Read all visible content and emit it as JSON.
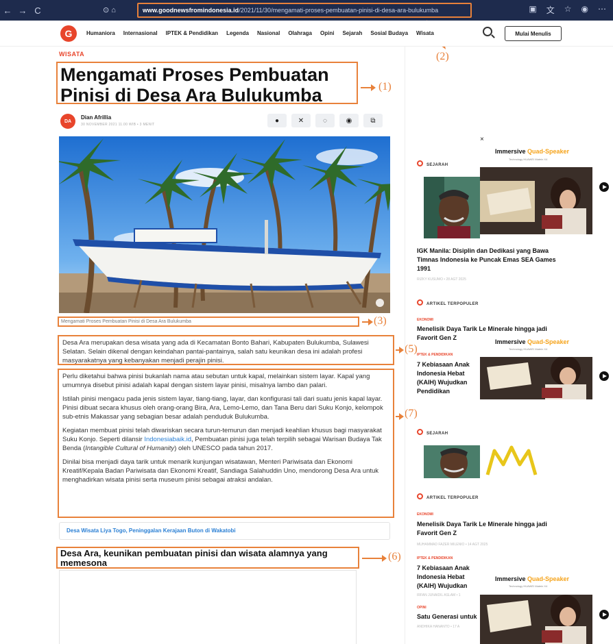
{
  "browser": {
    "url_domain": "www.goodnewsfromindonesia.id",
    "url_path": "/2021/11/30/mengamati-proses-pembuatan-pinisi-di-desa-ara-bulukumba",
    "back_icon": "←",
    "forward_icon": "→",
    "reload_icon": "C"
  },
  "site": {
    "logo_letter": "G",
    "menu": [
      "Humaniora",
      "Internasional",
      "IPTEK & Pendidikan",
      "Legenda",
      "Nasional",
      "Olahraga",
      "Opini",
      "Sejarah",
      "Sosial Budaya",
      "Wisata"
    ],
    "write_button": "Mulai Menulis"
  },
  "annotations": {
    "a1": "(1)",
    "a2": "(2)",
    "a3": "(3)",
    "a5": "(5)",
    "a6": "(6)",
    "a7": "(7)"
  },
  "article": {
    "category": "WISATA",
    "title": "Mengamati Proses Pembuatan Pinisi di Desa Ara Bulukumba",
    "author_initials": "DA",
    "author": "Dian Afrillia",
    "meta": "30 NOVEMBER 2021 11.00 WIB • 3 MENIT",
    "share_icons": [
      "facebook-icon",
      "x-icon",
      "whatsapp-icon",
      "telegram-icon",
      "copy-link-icon"
    ],
    "caption": "Mengamati Proses Pembuatan Pinisi di Desa Ara Bulukumba",
    "intro": "Desa Ara merupakan desa wisata yang ada di Kecamatan Bonto Bahari, Kabupaten Bulukumba, Sulawesi Selatan. Selain dikenal dengan keindahan pantai-pantainya, salah satu keunikan desa ini adalah profesi masyarakatnya yang kebanyakan menjadi perajin pinisi.",
    "p1": "Perlu diketahui bahwa pinisi bukanlah nama atau sebutan untuk kapal, melainkan sistem layar. Kapal yang umumnya disebut pinisi adalah kapal dengan sistem layar pinisi, misalnya lambo dan palari.",
    "p2": "Istilah pinisi mengacu pada jenis sistem layar, tiang-tiang, layar, dan konfigurasi tali dari suatu jenis kapal layar. Pinisi dibuat secara khusus oleh orang-orang Bira, Ara, Lemo-Lemo, dan Tana Beru dari Suku Konjo, kelompok sub-etnis Makassar yang sebagian besar adalah penduduk Bulukumba.",
    "p3_a": "Kegiatan membuat pinisi telah diwariskan secara turun-temurun dan menjadi keahlian khusus bagi masyarakat Suku Konjo. Seperti dilansir ",
    "p3_link": "Indonesiabaik.id",
    "p3_b": ", Pembuatan pinisi juga telah terpilih sebagai Warisan Budaya Tak Benda (",
    "p3_i": "Intangible Cultural of Humanity",
    "p3_c": ") oleh UNESCO pada tahun 2017.",
    "p4": "Dinilai bisa menjadi daya tarik untuk menarik kunjungan wisatawan, Menteri Pariwisata dan Ekonomi Kreatif/Kepala Badan Pariwisata dan Ekonomi Kreatif, Sandiaga Salahuddin Uno, mendorong Desa Ara untuk menghadirkan wisata pinisi serta museum pinisi sebagai atraksi andalan.",
    "related": "Desa Wisata Liya Togo, Peninggalan Kerajaan Buton di Wakatobi",
    "h2": "Desa Ara, keunikan pembuatan pinisi dan wisata alamnya yang memesona"
  },
  "sidebar": {
    "sejarah_label": "SEJARAH",
    "sejarah_title": "IGK Manila: Disiplin dan Dedikasi yang Bawa Timnas Indonesia ke Puncak Emas SEA Games 1991",
    "sejarah_meta": "RIZKY KUSUMO • 28 AGT 2025",
    "popular_label": "ARTIKEL TERPOPULER",
    "pop1_cat": "EKONOMI",
    "pop1_title": "Menelisik Daya Tarik Le Minerale hingga jadi Favorit Gen Z",
    "pop1_meta": "MUHAMMAD FAZER MILENIO • 14 AGT 2025",
    "pop2_cat": "IPTEK & PENDIDIKAN",
    "pop2_title": "7 Kebiasaan Anak Indonesia Hebat (KAIH) Wujudkan Pendidikan Indonesia Emas 2045",
    "pop2_meta": "IRFAN JUNAIDIL ASLAM • 1",
    "pop3_cat": "OPINI",
    "pop3_title": "Satu Generasi untuk",
    "pop3_meta": "ANDHIKA HANANTO • 17 A",
    "ad_title_a": "Immersive ",
    "ad_title_b": "Quad-Speaker",
    "ad_sub": "Technology HUAWEI Matein X4",
    "close": "×"
  }
}
